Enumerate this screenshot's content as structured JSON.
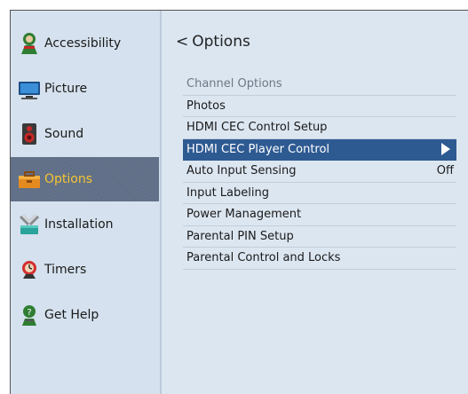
{
  "sidebar": {
    "items": [
      {
        "label": "Accessibility",
        "icon": "accessibility-person-icon",
        "selected": false
      },
      {
        "label": "Picture",
        "icon": "tv-screen-icon",
        "selected": false
      },
      {
        "label": "Sound",
        "icon": "speaker-icon",
        "selected": false
      },
      {
        "label": "Options",
        "icon": "options-toolbox-icon",
        "selected": true
      },
      {
        "label": "Installation",
        "icon": "tools-icon",
        "selected": false
      },
      {
        "label": "Timers",
        "icon": "timer-clock-icon",
        "selected": false
      },
      {
        "label": "Get Help",
        "icon": "help-person-icon",
        "selected": false
      }
    ]
  },
  "main": {
    "title": "Options",
    "back_glyph": "<",
    "rows": [
      {
        "label": "Channel Options",
        "value": "",
        "state": "dim"
      },
      {
        "label": "Photos",
        "value": "",
        "state": "normal"
      },
      {
        "label": "HDMI CEC Control Setup",
        "value": "",
        "state": "normal"
      },
      {
        "label": "HDMI CEC Player Control",
        "value": "",
        "state": "selected",
        "arrow": "play-arrow-icon"
      },
      {
        "label": "Auto Input Sensing",
        "value": "Off",
        "state": "normal"
      },
      {
        "label": "Input Labeling",
        "value": "",
        "state": "normal"
      },
      {
        "label": "Power Management",
        "value": "",
        "state": "normal"
      },
      {
        "label": "Parental PIN Setup",
        "value": "",
        "state": "normal"
      },
      {
        "label": "Parental Control and Locks",
        "value": "",
        "state": "normal"
      }
    ]
  },
  "colors": {
    "sidebar_bg": "#d5e1ee",
    "main_bg": "#dce6f1",
    "sidebar_selected": "#5f6e86",
    "sidebar_selected_text": "#f4c430",
    "row_selected": "#2e5a92"
  }
}
